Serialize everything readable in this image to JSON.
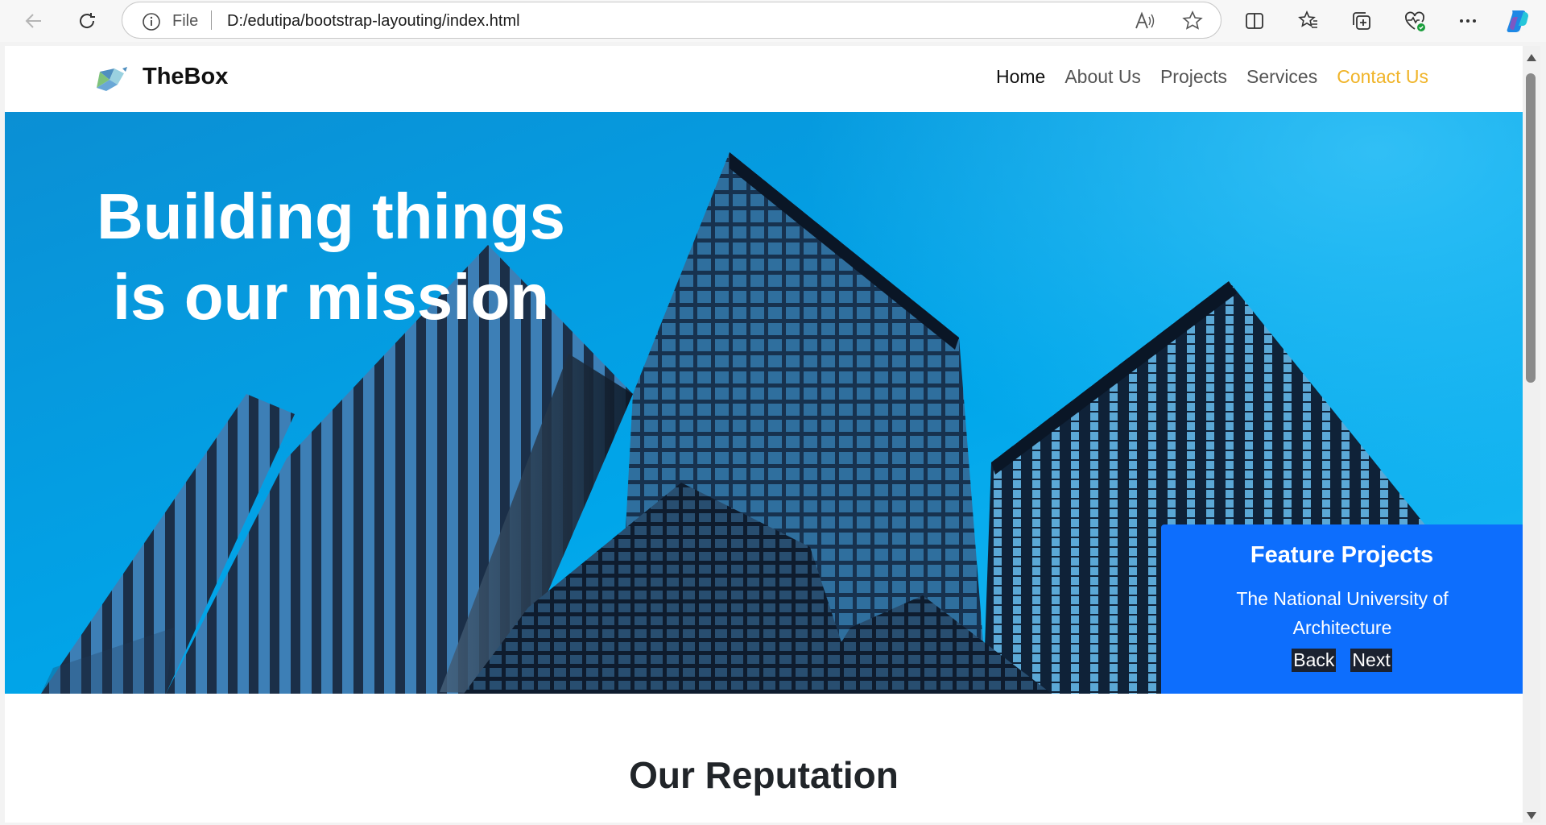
{
  "browser": {
    "file_label": "File",
    "url": "D:/edutipa/bootstrap-layouting/index.html"
  },
  "nav": {
    "brand": "TheBox",
    "links": [
      {
        "label": "Home",
        "state": "active"
      },
      {
        "label": "About Us",
        "state": "default"
      },
      {
        "label": "Projects",
        "state": "default"
      },
      {
        "label": "Services",
        "state": "default"
      },
      {
        "label": "Contact Us",
        "state": "highlight"
      }
    ]
  },
  "hero": {
    "title_line1": "Building things",
    "title_line2": "is our mission",
    "feature": {
      "title": "Feature Projects",
      "subtitle": "The National University of Architecture",
      "back_label": "Back",
      "next_label": "Next"
    }
  },
  "section": {
    "title": "Our Reputation"
  },
  "colors": {
    "accent": "#0d6efd",
    "contact": "#f0b429",
    "sky": "#00a6ea"
  }
}
